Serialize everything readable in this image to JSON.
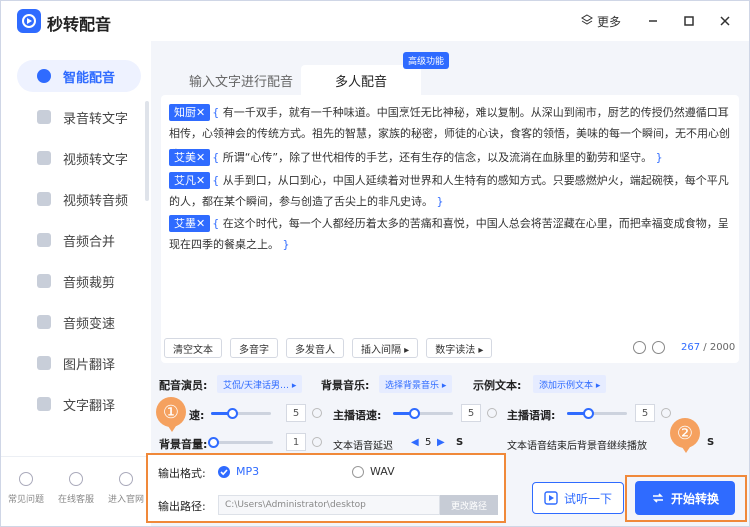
{
  "app": {
    "title": "秒转配音",
    "more_label": "更多"
  },
  "sidebar": {
    "items": [
      {
        "label": "智能配音"
      },
      {
        "label": "录音转文字"
      },
      {
        "label": "视频转文字"
      },
      {
        "label": "视频转音频"
      },
      {
        "label": "音频合并"
      },
      {
        "label": "音频裁剪"
      },
      {
        "label": "音频变速"
      },
      {
        "label": "图片翻译"
      },
      {
        "label": "文字翻译"
      }
    ],
    "bottom": [
      {
        "label": "常见问题"
      },
      {
        "label": "在线客服"
      },
      {
        "label": "进入官网"
      }
    ]
  },
  "tabs": [
    {
      "label": "输入文字进行配音"
    },
    {
      "label": "多人配音"
    }
  ],
  "badge": "高级功能",
  "editor": {
    "paragraphs": [
      {
        "speaker": "知厨✕",
        "text": "有一千双手，就有一千种味道。中国烹饪无比神秘，难以复制。从深山到闹市，厨艺的传授仍然遵循口耳相传，心领神会的传统方式。祖先的智慧，家族的秘密，师徒的心诀，食客的领悟，美味的每一个瞬间，无不用心创造。"
      },
      {
        "speaker": "艾美✕",
        "text": "所谓“心传”，除了世代相传的手艺，还有生存的信念，以及流淌在血脉里的勤劳和坚守。"
      },
      {
        "speaker": "艾凡✕",
        "text": "从手到口，从口到心，中国人延续着对世界和人生特有的感知方式。只要感燃炉火，端起碗筷，每个平凡的人，都在某个瞬间，参与创造了舌尖上的非凡史诗。"
      },
      {
        "speaker": "艾墨✕",
        "text": "在这个时代，每一个人都经历着太多的苦痛和喜悦，中国人总会将苦涩藏在心里，而把幸福变成食物，呈现在四季的餐桌之上。"
      }
    ],
    "brace_open": "{",
    "brace_close": "}"
  },
  "toolbar": {
    "buttons": [
      {
        "label": "清空文本"
      },
      {
        "label": "多音字"
      },
      {
        "label": "多发音人"
      },
      {
        "label": "插入间隔 ▸"
      },
      {
        "label": "数字读法 ▸"
      }
    ],
    "count_current": "267",
    "count_total": "/ 2000"
  },
  "settings": {
    "voice_label": "配音演员:",
    "voice_value": "艾侃/天津话男… ▸",
    "bgm_label": "背景音乐:",
    "bgm_value": "选择背景音乐 ▸",
    "sample_label": "示例文本:",
    "sample_value": "添加示例文本 ▸",
    "speed_label_partial": "速:",
    "speed_value": "5",
    "main_speed_label": "主播语速:",
    "main_speed_value": "5",
    "main_pitch_label": "主播语调:",
    "main_pitch_value": "5",
    "bg_volume_label": "背景音量:",
    "bg_volume_value": "1",
    "delay_label": "文本语音延迟",
    "delay_value": "5",
    "delay_unit": "S",
    "bg_continue_label": "文本语音结束后背景音继续播放",
    "bg_continue_unit": "S",
    "speed_level": 0.35,
    "main_speed_level": 0.35,
    "main_pitch_level": 0.35,
    "bg_volume_level": 0.0
  },
  "output": {
    "format_label": "输出格式:",
    "format_options": [
      "MP3",
      "WAV"
    ],
    "path_label": "输出路径:",
    "path_value": "C:\\Users\\Administrator\\desktop",
    "change_path_label": "更改路径"
  },
  "actions": {
    "preview_label": "试听一下",
    "convert_label": "开始转换"
  },
  "markers": [
    "①",
    "②"
  ]
}
